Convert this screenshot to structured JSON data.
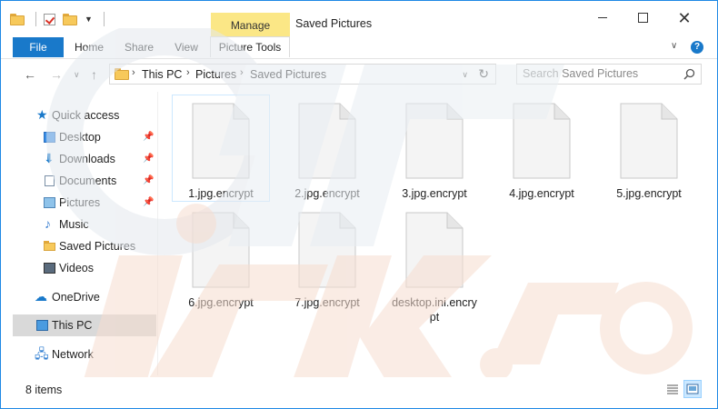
{
  "window": {
    "title": "Saved Pictures",
    "manage_label": "Manage",
    "accent_color": "#1979ca",
    "manage_color": "#fbe786"
  },
  "ribbon": {
    "file_label": "File",
    "tabs": [
      "Home",
      "Share",
      "View",
      "Picture Tools"
    ]
  },
  "address": {
    "crumbs": [
      "This PC",
      "Pictures",
      "Saved Pictures"
    ],
    "search_placeholder": "Search Saved Pictures"
  },
  "nav_pane": {
    "quick_access": "Quick access",
    "items": [
      {
        "label": "Desktop",
        "icon": "desktop-icon",
        "pinned": true
      },
      {
        "label": "Downloads",
        "icon": "download-icon",
        "pinned": true
      },
      {
        "label": "Documents",
        "icon": "documents-icon",
        "pinned": true
      },
      {
        "label": "Pictures",
        "icon": "pictures-icon",
        "pinned": true
      },
      {
        "label": "Music",
        "icon": "music-icon",
        "pinned": false
      },
      {
        "label": "Saved Pictures",
        "icon": "folder-icon",
        "pinned": false
      },
      {
        "label": "Videos",
        "icon": "videos-icon",
        "pinned": false
      }
    ],
    "onedrive": "OneDrive",
    "this_pc": "This PC",
    "network": "Network"
  },
  "files": [
    {
      "name": "1.jpg.encrypt"
    },
    {
      "name": "2.jpg.encrypt"
    },
    {
      "name": "3.jpg.encrypt"
    },
    {
      "name": "4.jpg.encrypt"
    },
    {
      "name": "5.jpg.encrypt"
    },
    {
      "name": "6.jpg.encrypt"
    },
    {
      "name": "7.jpg.encrypt"
    },
    {
      "name": "desktop.ini.encrypt"
    }
  ],
  "status": {
    "item_count": "8 items"
  }
}
